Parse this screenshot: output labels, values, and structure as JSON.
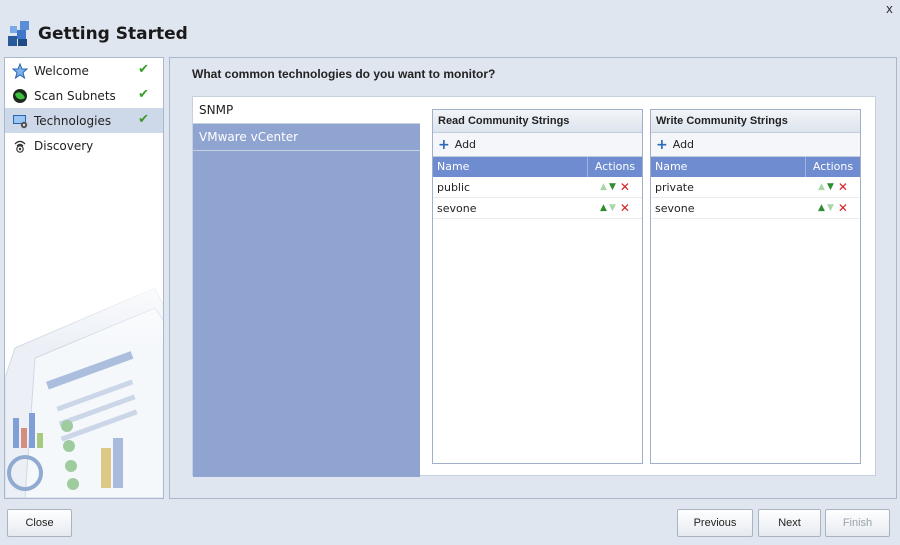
{
  "window": {
    "title": "Getting Started",
    "close_label": "x"
  },
  "sidebar": {
    "items": [
      {
        "label": "Welcome",
        "icon": "star-icon",
        "done": true
      },
      {
        "label": "Scan Subnets",
        "icon": "globe-icon",
        "done": true
      },
      {
        "label": "Technologies",
        "icon": "monitor-icon",
        "done": true,
        "selected": true
      },
      {
        "label": "Discovery",
        "icon": "discovery-icon",
        "done": false
      }
    ]
  },
  "main": {
    "question": "What common technologies do you want to monitor?",
    "technologies": [
      {
        "label": "SNMP",
        "active": true
      },
      {
        "label": "VMware vCenter",
        "active": false
      }
    ],
    "read_grid": {
      "title": "Read Community Strings",
      "add_label": "Add",
      "col_name": "Name",
      "col_actions": "Actions",
      "rows": [
        {
          "name": "public",
          "up_enabled": false,
          "down_enabled": true
        },
        {
          "name": "sevone",
          "up_enabled": true,
          "down_enabled": false
        }
      ]
    },
    "write_grid": {
      "title": "Write Community Strings",
      "add_label": "Add",
      "col_name": "Name",
      "col_actions": "Actions",
      "rows": [
        {
          "name": "private",
          "up_enabled": false,
          "down_enabled": true
        },
        {
          "name": "sevone",
          "up_enabled": true,
          "down_enabled": false
        }
      ]
    }
  },
  "footer": {
    "close_label": "Close",
    "previous_label": "Previous",
    "next_label": "Next",
    "finish_label": "Finish"
  },
  "colors": {
    "tech_list_bg": "#8fa4d0",
    "grid_header_bg": "#6e8ccf",
    "check_green": "#3a9b2b",
    "delete_red": "#d42020"
  }
}
